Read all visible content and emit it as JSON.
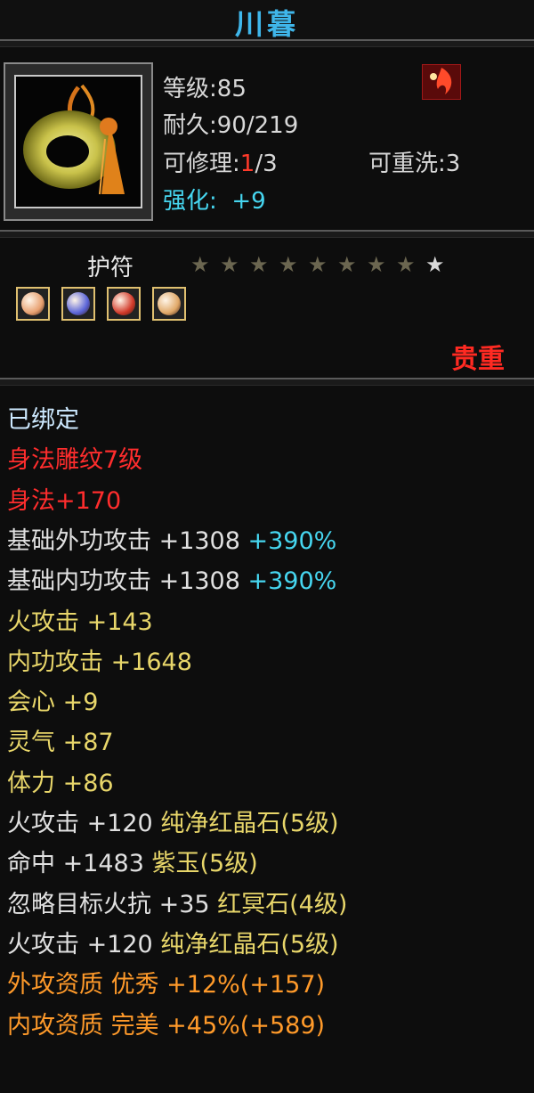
{
  "title": "川暮",
  "item": {
    "level_label": "等级",
    "level": "85",
    "durability_label": "耐久",
    "durability": "90/219",
    "repair_label": "可修理",
    "repair_used": "1",
    "repair_total": "/3",
    "rewash_label": "可重洗",
    "rewash": "3",
    "enhance_label": "强化",
    "enhance": "+9",
    "type": "护符",
    "stars_filled": 8,
    "stars_total": 9,
    "quality": "贵重",
    "colors": {
      "title": "#3fb6ea",
      "star_filled": "#6b6650",
      "star_empty": "#d8d8d8",
      "quality": "#ff2a22"
    }
  },
  "gems": [
    {
      "name": "orange-gem",
      "color": "#e8a070"
    },
    {
      "name": "blue-gem",
      "color": "#5a64d8"
    },
    {
      "name": "red-gem",
      "color": "#d23a2a"
    },
    {
      "name": "gold-gem",
      "color": "#e0a868"
    }
  ],
  "attributes": [
    {
      "text": "已绑定",
      "color": "lbl"
    },
    {
      "text": "身法雕纹7级",
      "color": "rd"
    },
    {
      "text": "身法+170",
      "color": "rd"
    },
    {
      "text": "基础外功攻击  +1308",
      "extra": "+390%",
      "color": "wht"
    },
    {
      "text": "基础内功攻击  +1308",
      "extra": "+390%",
      "color": "wht"
    },
    {
      "text": "火攻击  +143",
      "color": "ylw"
    },
    {
      "text": "内功攻击  +1648",
      "color": "ylw"
    },
    {
      "text": "会心  +9",
      "color": "ylw"
    },
    {
      "text": "灵气  +87",
      "color": "ylw"
    },
    {
      "text": "体力  +86",
      "color": "ylw"
    },
    {
      "text": "火攻击  +120",
      "extra": "纯净红晶石(5级)",
      "color": "wht"
    },
    {
      "text": "命中  +1483",
      "extra": "紫玉(5级)",
      "color": "wht"
    },
    {
      "text": "忽略目标火抗  +35",
      "extra": "红冥石(4级)",
      "color": "wht"
    },
    {
      "text": "火攻击  +120",
      "extra": "纯净红晶石(5级)",
      "color": "wht"
    },
    {
      "text": "外攻资质   优秀  +12%(+157)",
      "color": "org"
    },
    {
      "text": "内攻资质   完美  +45%(+589)",
      "color": "org"
    }
  ]
}
